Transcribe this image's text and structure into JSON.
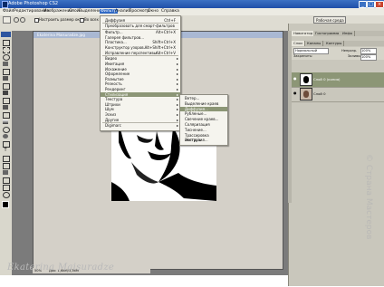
{
  "window": {
    "title": "Adobe Photoshop CS2",
    "min": "_",
    "max": "□",
    "close": "×"
  },
  "menubar": [
    {
      "label": "Файл"
    },
    {
      "label": "Редактирование"
    },
    {
      "label": "Изображение"
    },
    {
      "label": "Слой"
    },
    {
      "label": "Выделение"
    },
    {
      "label": "Фильтр"
    },
    {
      "label": "Анализ"
    },
    {
      "label": "Просмотр"
    },
    {
      "label": "Окно"
    },
    {
      "label": "Справка"
    }
  ],
  "options": {
    "snap_checkbox_label": "Настроить размер окон",
    "all_windows_label": "Во всех",
    "workspace_label": "Рабочая среда"
  },
  "document": {
    "title": "Ekaterina Maisuradze.jpg"
  },
  "filter_menu": {
    "items": [
      {
        "label": "Диффузия",
        "shortcut": "Ctrl+F",
        "sep_after": true
      },
      {
        "label": "Преобразовать для смарт-фильтров",
        "sep_after": true
      },
      {
        "label": "Фильтр...",
        "shortcut": "Alt+Ctrl+X"
      },
      {
        "label": "Галерея фильтров..."
      },
      {
        "label": "Пластика...",
        "shortcut": "Shift+Ctrl+X"
      },
      {
        "label": "Конструктор узоров...",
        "shortcut": "Alt+Shift+Ctrl+X"
      },
      {
        "label": "Исправление перспективы...",
        "shortcut": "Alt+Ctrl+V",
        "sep_after": true
      },
      {
        "label": "Видео",
        "submenu": true
      },
      {
        "label": "Имитация",
        "submenu": true
      },
      {
        "label": "Искажение",
        "submenu": true
      },
      {
        "label": "Оформление",
        "submenu": true
      },
      {
        "label": "Размытие",
        "submenu": true
      },
      {
        "label": "Резкость",
        "submenu": true
      },
      {
        "label": "Рендеринг",
        "submenu": true
      },
      {
        "label": "Стилизация",
        "submenu": true,
        "highlighted": true
      },
      {
        "label": "Текстура",
        "submenu": true
      },
      {
        "label": "Штрихи",
        "submenu": true
      },
      {
        "label": "Шум",
        "submenu": true
      },
      {
        "label": "Эскиз",
        "submenu": true
      },
      {
        "label": "Другие",
        "submenu": true,
        "sep_after": true
      },
      {
        "label": "Digimarc",
        "submenu": true
      }
    ]
  },
  "stylize_submenu": {
    "items": [
      {
        "label": "Ветер..."
      },
      {
        "label": "Выделение краев"
      },
      {
        "label": "Диффузия...",
        "highlighted": true
      },
      {
        "label": "Рубленые..."
      },
      {
        "label": "Свечение краев..."
      },
      {
        "label": "Соляризация"
      },
      {
        "label": "Тиснение..."
      },
      {
        "label": "Трассировка контура..."
      },
      {
        "label": "Экструзия..."
      }
    ]
  },
  "panels": {
    "top_tabs": [
      "Навигатор",
      "Гистограмма",
      "Инфо"
    ],
    "layer_tabs": [
      "Слои",
      "Каналы",
      "Контуры"
    ],
    "blend_mode": "Нормальный",
    "opacity_label": "Непрозр.",
    "opacity_value": "100%",
    "lock_label": "Закрепить:",
    "fill_label": "Заливка",
    "fill_value": "100%",
    "layers": [
      {
        "name": "Слой 0 (копия)",
        "selected": true
      },
      {
        "name": "Слой 0",
        "selected": false
      }
    ]
  },
  "status": {
    "zoom": "50%",
    "doc_info": "Док: 1,68M/3,36M"
  },
  "signature": "Ekaterina Maisuradze",
  "watermark": "© Страна Мастеров",
  "colors": {
    "highlight": "#8c9676",
    "titlebar": "#2a5db5",
    "workspace": "#7b7b7b"
  }
}
